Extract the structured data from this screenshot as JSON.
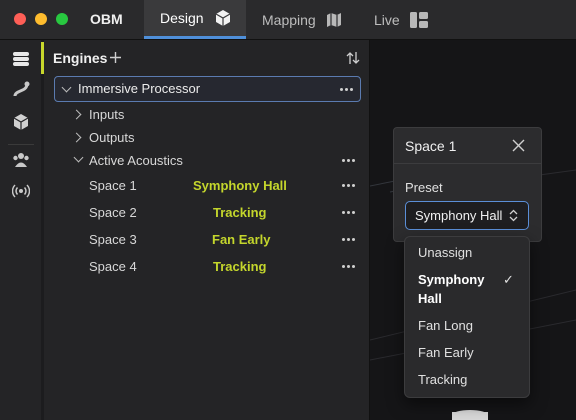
{
  "titlebar": {
    "app_name": "OBM",
    "tabs": [
      {
        "label": "Design",
        "icon": "cube-icon",
        "active": true
      },
      {
        "label": "Mapping",
        "icon": "map-icon",
        "active": false
      },
      {
        "label": "Live",
        "icon": "dashboard-icon",
        "active": false
      }
    ]
  },
  "sidebar": {
    "icons": [
      "database-icon",
      "path-icon",
      "cube-icon",
      "people-icon",
      "broadcast-icon"
    ]
  },
  "panel": {
    "title": "Engines",
    "processor": "Immersive Processor",
    "inputs": "Inputs",
    "outputs": "Outputs",
    "acoustics": "Active Acoustics",
    "spaces": [
      {
        "name": "Space 1",
        "preset": "Symphony Hall"
      },
      {
        "name": "Space 2",
        "preset": "Tracking"
      },
      {
        "name": "Space 3",
        "preset": "Fan Early"
      },
      {
        "name": "Space 4",
        "preset": "Tracking"
      }
    ]
  },
  "popover": {
    "title": "Space 1",
    "preset_label": "Preset",
    "selected": "Symphony Hall",
    "options": [
      "Unassign",
      "Symphony Hall",
      "Fan Long",
      "Fan Early",
      "Tracking"
    ],
    "opt1_line1": "Symphony",
    "opt1_line2": "Hall",
    "checkmark": "✓"
  },
  "colors": {
    "accent": "#c4d62c",
    "tab_underline": "#4f8fd9"
  }
}
